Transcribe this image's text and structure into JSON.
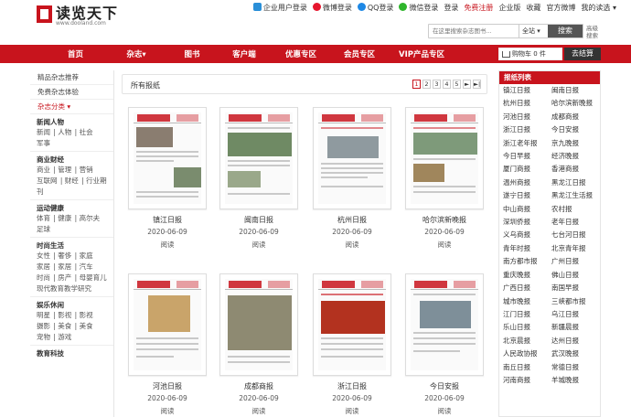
{
  "logo": {
    "name": "读览天下",
    "domain": "www.dooland.com"
  },
  "toplinks": [
    "企业用户登录",
    "微博登录",
    "QQ登录",
    "微信登录",
    "登录",
    "免费注册",
    "企业版",
    "收藏",
    "官方微博",
    "我的读选"
  ],
  "search": {
    "placeholder": "在这里搜索杂志图书...",
    "scope": "全站",
    "button": "搜索",
    "advanced": "高级搜索"
  },
  "nav": [
    "首页",
    "杂志",
    "图书",
    "客户端",
    "优惠专区",
    "会员专区",
    "VIP产品专区"
  ],
  "cart": {
    "label": "购物车 0 件",
    "checkout": "去结算"
  },
  "sidebar": {
    "pills": [
      "精品杂志推荐",
      "免费杂志体验",
      "杂志分类"
    ],
    "categories": [
      {
        "title": "新闻人物",
        "links": [
          "新闻",
          "人物",
          "社会",
          "军事"
        ]
      },
      {
        "title": "商业财经",
        "links": [
          "商业",
          "管理",
          "营销",
          "互联网",
          "财经",
          "行业期刊"
        ]
      },
      {
        "title": "运动健康",
        "links": [
          "体育",
          "健康",
          "高尔夫",
          "足球"
        ]
      },
      {
        "title": "时尚生活",
        "links": [
          "女性",
          "奢侈",
          "家庭",
          "家居",
          "家居",
          "汽车",
          "时尚",
          "房产",
          "母婴育儿",
          "现代教育教学研究"
        ]
      },
      {
        "title": "娱乐休闲",
        "links": [
          "明星",
          "影视",
          "影视",
          "旅游",
          "摄影",
          "美食",
          "宠物",
          "游戏"
        ]
      },
      {
        "title": "教育科技",
        "links": []
      }
    ]
  },
  "main": {
    "title": "所有报纸",
    "pager": [
      "1",
      "2",
      "3",
      "4",
      "5",
      "►",
      "►|"
    ],
    "papers": [
      {
        "title": "镇江日报",
        "date": "2020-06-09",
        "read": "阅读"
      },
      {
        "title": "闽南日报",
        "date": "2020-06-09",
        "read": "阅读"
      },
      {
        "title": "杭州日报",
        "date": "2020-06-09",
        "read": "阅读"
      },
      {
        "title": "哈尔滨新晚报",
        "date": "2020-06-09",
        "read": "阅读"
      },
      {
        "title": "河池日报",
        "date": "2020-06-09",
        "read": "阅读"
      },
      {
        "title": "成都商报",
        "date": "2020-06-09",
        "read": "阅读"
      },
      {
        "title": "浙江日报",
        "date": "2020-06-09",
        "read": "阅读"
      },
      {
        "title": "今日安报",
        "date": "2020-06-09",
        "read": "阅读"
      }
    ]
  },
  "rlist": {
    "title": "报纸列表",
    "items": [
      "镇江日报",
      "闽南日报",
      "杭州日报",
      "哈尔滨新晚报",
      "河池日报",
      "成都商报",
      "浙江日报",
      "今日安报",
      "浙江老年报",
      "京九晚报",
      "今日早报",
      "经济晚报",
      "厦门商报",
      "香港商报",
      "温州商报",
      "黑龙江日报",
      "遂宁日报",
      "黑龙江生活报",
      "中山商报",
      "农村报",
      "深圳侨报",
      "老年日报",
      "义乌商报",
      "七台河日报",
      "青年时报",
      "北京青年报",
      "南方都市报",
      "广州日报",
      "重庆晚报",
      "佛山日报",
      "广西日报",
      "南国早报",
      "城市晚报",
      "三峡都市报",
      "江门日报",
      "乌江日报",
      "乐山日报",
      "新疆晨报",
      "北京晨报",
      "达州日报",
      "人民政协报",
      "武汉晚报",
      "南丘日报",
      "常德日报",
      "河南商报",
      "羊城晚报"
    ]
  },
  "colors": {
    "accent": "#c8141d"
  }
}
